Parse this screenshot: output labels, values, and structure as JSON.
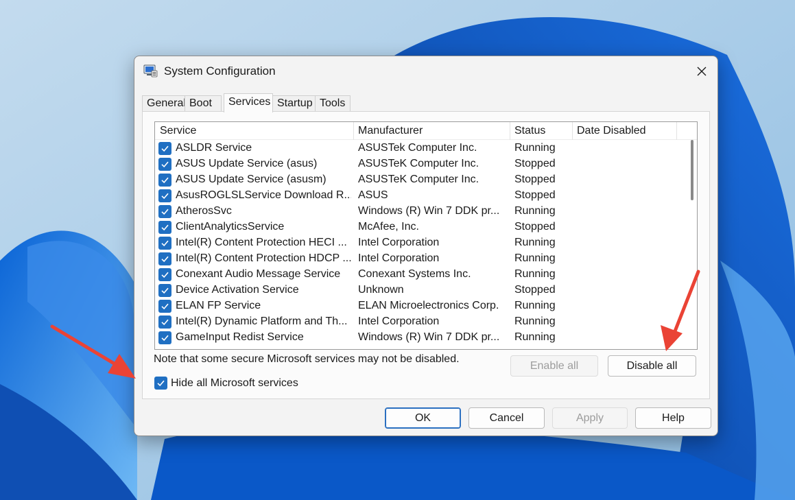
{
  "window": {
    "title": "System Configuration"
  },
  "tabs": [
    {
      "label": "General"
    },
    {
      "label": "Boot"
    },
    {
      "label": "Services",
      "active": true
    },
    {
      "label": "Startup"
    },
    {
      "label": "Tools"
    }
  ],
  "services_table": {
    "columns": [
      "Service",
      "Manufacturer",
      "Status",
      "Date Disabled"
    ],
    "rows": [
      {
        "service": "ASLDR Service",
        "manufacturer": "ASUSTek Computer Inc.",
        "status": "Running",
        "date_disabled": "",
        "checked": true
      },
      {
        "service": "ASUS Update Service (asus)",
        "manufacturer": "ASUSTeK Computer Inc.",
        "status": "Stopped",
        "date_disabled": "",
        "checked": true
      },
      {
        "service": "ASUS Update Service (asusm)",
        "manufacturer": "ASUSTeK Computer Inc.",
        "status": "Stopped",
        "date_disabled": "",
        "checked": true
      },
      {
        "service": "AsusROGLSLService Download R...",
        "manufacturer": "ASUS",
        "status": "Stopped",
        "date_disabled": "",
        "checked": true
      },
      {
        "service": "AtherosSvc",
        "manufacturer": "Windows (R) Win 7 DDK pr...",
        "status": "Running",
        "date_disabled": "",
        "checked": true
      },
      {
        "service": "ClientAnalyticsService",
        "manufacturer": "McAfee, Inc.",
        "status": "Stopped",
        "date_disabled": "",
        "checked": true
      },
      {
        "service": "Intel(R) Content Protection HECI ...",
        "manufacturer": "Intel Corporation",
        "status": "Running",
        "date_disabled": "",
        "checked": true
      },
      {
        "service": "Intel(R) Content Protection HDCP ...",
        "manufacturer": "Intel Corporation",
        "status": "Running",
        "date_disabled": "",
        "checked": true
      },
      {
        "service": "Conexant Audio Message Service",
        "manufacturer": "Conexant Systems Inc.",
        "status": "Running",
        "date_disabled": "",
        "checked": true
      },
      {
        "service": "Device Activation Service",
        "manufacturer": "Unknown",
        "status": "Stopped",
        "date_disabled": "",
        "checked": true
      },
      {
        "service": "ELAN FP Service",
        "manufacturer": "ELAN Microelectronics Corp.",
        "status": "Running",
        "date_disabled": "",
        "checked": true
      },
      {
        "service": "Intel(R) Dynamic Platform and Th...",
        "manufacturer": "Intel Corporation",
        "status": "Running",
        "date_disabled": "",
        "checked": true
      },
      {
        "service": "GameInput Redist Service",
        "manufacturer": "Windows (R) Win 7 DDK pr...",
        "status": "Running",
        "date_disabled": "",
        "checked": true
      }
    ]
  },
  "note": "Note that some secure Microsoft services may not be disabled.",
  "buttons": {
    "enable_all": "Enable all",
    "disable_all": "Disable all",
    "ok": "OK",
    "cancel": "Cancel",
    "apply": "Apply",
    "help": "Help"
  },
  "hide_ms": {
    "label": "Hide all Microsoft services",
    "checked": true
  },
  "colors": {
    "accent": "#1f6fc2",
    "annotation_arrow": "#ea4335"
  },
  "icons": {
    "app": "system-configuration-icon",
    "close": "close-icon",
    "check": "checkmark-icon"
  }
}
